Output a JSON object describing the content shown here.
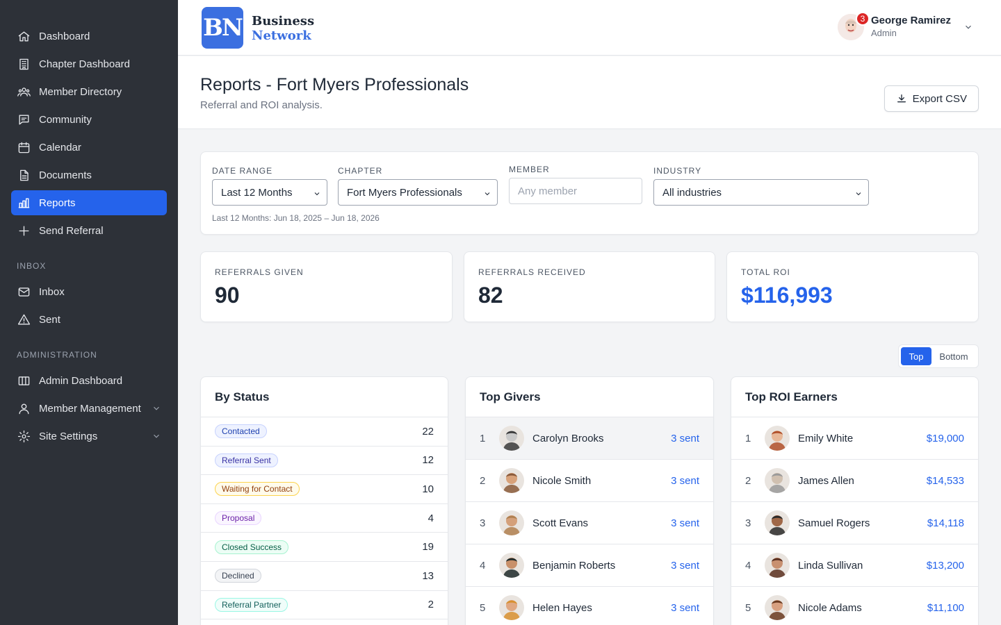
{
  "nav": {
    "main": [
      {
        "label": "Dashboard",
        "icon": "home-icon"
      },
      {
        "label": "Chapter Dashboard",
        "icon": "building-icon"
      },
      {
        "label": "Member Directory",
        "icon": "users-icon"
      },
      {
        "label": "Community",
        "icon": "chat-icon"
      },
      {
        "label": "Calendar",
        "icon": "calendar-icon"
      },
      {
        "label": "Documents",
        "icon": "document-icon"
      },
      {
        "label": "Reports",
        "icon": "bar-chart-icon"
      },
      {
        "label": "Send Referral",
        "icon": "plus-icon"
      }
    ],
    "inbox_heading": "INBOX",
    "inbox": [
      {
        "label": "Inbox",
        "icon": "mail-icon"
      },
      {
        "label": "Sent",
        "icon": "warning-icon"
      }
    ],
    "admin_heading": "ADMINISTRATION",
    "admin": [
      {
        "label": "Admin Dashboard",
        "icon": "columns-icon"
      },
      {
        "label": "Member Management",
        "icon": "user-icon"
      },
      {
        "label": "Site Settings",
        "icon": "gear-icon"
      }
    ]
  },
  "header": {
    "logo_text": "BN",
    "brand_line1": "Business",
    "brand_line2": "Network",
    "user_name": "George Ramirez",
    "user_role": "Admin",
    "notification_count": "3"
  },
  "page": {
    "title": "Reports - Fort Myers Professionals",
    "subtitle": "Referral and ROI analysis.",
    "export_label": "Export CSV"
  },
  "filters": {
    "date_range_label": "DATE RANGE",
    "date_range_value": "Last 12 Months",
    "chapter_label": "CHAPTER",
    "chapter_value": "Fort Myers Professionals",
    "member_label": "MEMBER",
    "member_placeholder": "Any member",
    "industry_label": "INDUSTRY",
    "industry_value": "All industries",
    "hint": "Last 12 Months: Jun 18, 2025 – Jun 18, 2026"
  },
  "stats": {
    "given_label": "REFERRALS GIVEN",
    "given_value": "90",
    "received_label": "REFERRALS RECEIVED",
    "received_value": "82",
    "roi_label": "TOTAL ROI",
    "roi_value": "$116,993"
  },
  "toggle": {
    "top": "Top",
    "bottom": "Bottom"
  },
  "by_status": {
    "title": "By Status",
    "rows": [
      {
        "label": "Contacted",
        "count": "22",
        "fg": "#1e40af",
        "bg": "#eef2ff",
        "border": "#c7d2fe"
      },
      {
        "label": "Referral Sent",
        "count": "12",
        "fg": "#3730a3",
        "bg": "#eef2ff",
        "border": "#c7d2fe"
      },
      {
        "label": "Waiting for Contact",
        "count": "10",
        "fg": "#92400e",
        "bg": "#fffbeb",
        "border": "#fcd34d"
      },
      {
        "label": "Proposal",
        "count": "4",
        "fg": "#6b21a8",
        "bg": "#faf5ff",
        "border": "#e9d5ff"
      },
      {
        "label": "Closed Success",
        "count": "19",
        "fg": "#065f46",
        "bg": "#ecfdf5",
        "border": "#a7f3d0"
      },
      {
        "label": "Declined",
        "count": "13",
        "fg": "#374151",
        "bg": "#f3f4f6",
        "border": "#d1d5db"
      },
      {
        "label": "Referral Partner",
        "count": "2",
        "fg": "#115e59",
        "bg": "#f0fdfa",
        "border": "#99f6e4"
      }
    ]
  },
  "top_givers": {
    "title": "Top Givers",
    "rows": [
      {
        "rank": "1",
        "name": "Carolyn Brooks",
        "value": "3 sent",
        "skin": "#c9c9c9",
        "hair": "#3a3a3a"
      },
      {
        "rank": "2",
        "name": "Nicole Smith",
        "value": "3 sent",
        "skin": "#d8a27a",
        "hair": "#8a5a3a"
      },
      {
        "rank": "3",
        "name": "Scott Evans",
        "value": "3 sent",
        "skin": "#d4a07a",
        "hair": "#b08050"
      },
      {
        "rank": "4",
        "name": "Benjamin Roberts",
        "value": "3 sent",
        "skin": "#c8906a",
        "hair": "#1f2a2a"
      },
      {
        "rank": "5",
        "name": "Helen Hayes",
        "value": "3 sent",
        "skin": "#e0a882",
        "hair": "#d89030"
      }
    ]
  },
  "top_roi": {
    "title": "Top ROI Earners",
    "rows": [
      {
        "rank": "1",
        "name": "Emily White",
        "value": "$19,000",
        "skin": "#e8b898",
        "hair": "#b0502a"
      },
      {
        "rank": "2",
        "name": "James Allen",
        "value": "$14,533",
        "skin": "#d0c0b0",
        "hair": "#9a9a9a"
      },
      {
        "rank": "3",
        "name": "Samuel Rogers",
        "value": "$14,118",
        "skin": "#a06848",
        "hair": "#2a2a2a"
      },
      {
        "rank": "4",
        "name": "Linda Sullivan",
        "value": "$13,200",
        "skin": "#c89070",
        "hair": "#5a3020"
      },
      {
        "rank": "5",
        "name": "Nicole Adams",
        "value": "$11,100",
        "skin": "#d8a080",
        "hair": "#6a3a20"
      }
    ]
  }
}
